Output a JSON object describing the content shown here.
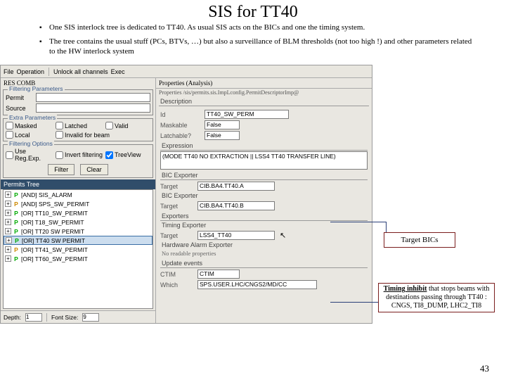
{
  "title": "SIS for TT40",
  "bullets": [
    "One SIS interlock tree is dedicated to TT40. As usual SIS acts on the BICs and one the timing system.",
    "The tree contains the usual stuff (PCs, BTVs, …) but also a surveillance of BLM thresholds (not too high !) and other parameters related to the HW interlock system"
  ],
  "toolbar": {
    "menu1": "File",
    "menu2": "Operation",
    "btn": "Unlock all channels",
    "btn2": "Exec"
  },
  "filtering_label": "RES COMB",
  "groups": {
    "filt_params": "Filtering Parameters",
    "extra_params": "Extra Parameters",
    "filt_opts": "Filtering Options"
  },
  "labels": {
    "permit": "Permit",
    "source": "Source"
  },
  "checks": {
    "masked": "Masked",
    "latched": "Latched",
    "valid": "Valid",
    "local": "Local",
    "inv": "Invalid for beam"
  },
  "opts": {
    "regex": "Use Reg.Exp.",
    "invert": "Invert filtering",
    "treeview": "TreeView"
  },
  "btns": {
    "filter": "Filter",
    "clear": "Clear"
  },
  "tree_header": "Permits Tree",
  "tree": [
    {
      "p": "P",
      "label": "[AND] SIS_ALARM"
    },
    {
      "p": "P",
      "label": "[AND] SPS_SW_PERMIT",
      "amber": true
    },
    {
      "p": "P",
      "label": "[OR] TT10_SW_PERMIT"
    },
    {
      "p": "P",
      "label": "[OR] T18_SW_PERMIT"
    },
    {
      "p": "P",
      "label": "[OR] TT20 SW PERMIT"
    },
    {
      "p": "P",
      "label": "[OR] TT40 SW PERMIT",
      "sel": true
    },
    {
      "p": "P",
      "label": "[OR] TT41_SW_PERMIT",
      "amber": true
    },
    {
      "p": "P",
      "label": "[OR] TT60_SW_PERMIT"
    }
  ],
  "status": {
    "depth": "Depth:",
    "depth_v": "1",
    "font": "Font Size:",
    "font_v": "9"
  },
  "props": {
    "panel": "Properties (Analysis)",
    "path": "Properties /sis/permits.sis.ImpLconfig.PermitDescriptorImp@",
    "desc": "Description",
    "id": "Id",
    "id_v": "TT40_SW_PERM",
    "maskable": "Maskable",
    "maskable_v": "False",
    "latchable": "Latchable?",
    "latchable_v": "False",
    "expr": "Expression",
    "expr_v": "(MODE TT40 NO EXTRACTION || LSS4 TT40 TRANSFER LINE)",
    "bicexp": "BIC Exporter",
    "target1": "Target",
    "target1_v": "CIB.BA4.TT40.A",
    "target2": "Target",
    "target2_v": "CIB.BA4.TT40.B",
    "exporters": "Exporters",
    "timingexp": "Timing Exporter",
    "target3": "Target",
    "target3_v": "LSS4_TT40",
    "hwalarm": "Hardware Alarm Exporter",
    "noread": "No readable properties",
    "update": "Update events",
    "ctim": "CTIM",
    "ctim_v": "CTIM",
    "which": "Which",
    "which_v": "SPS.USER.LHC/CNGS2/MD/CC"
  },
  "callouts": {
    "target": "Target BICs",
    "timing_u": "Timing inhibit",
    "timing_rest": " that stops beams with destinations passing through TT40 : CNGS, TI8_DUMP, LHC2_TI8"
  },
  "page": "43"
}
